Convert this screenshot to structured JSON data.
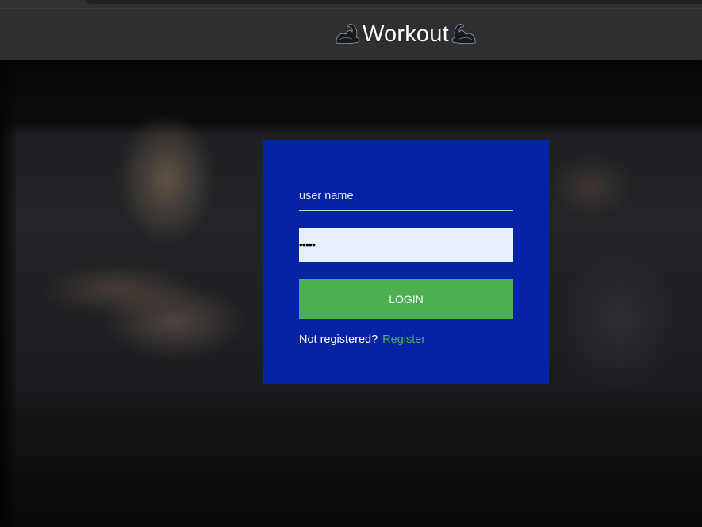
{
  "header": {
    "title": "Workout",
    "icon_left": "flexed-biceps-left-icon",
    "icon_right": "flexed-biceps-right-icon"
  },
  "background": {
    "image": "fitness-couple-plank-photo"
  },
  "login_form": {
    "username_placeholder": "user name",
    "username_value": "",
    "password_masked": "•••••",
    "login_label": "LOGIN",
    "not_registered_text": "Not registered?",
    "register_link": "Register"
  },
  "colors": {
    "header_bg": "#2e2f30",
    "card_bg": "#0524af",
    "accent_green": "#4caf50",
    "password_bg": "#e8f0fe"
  }
}
